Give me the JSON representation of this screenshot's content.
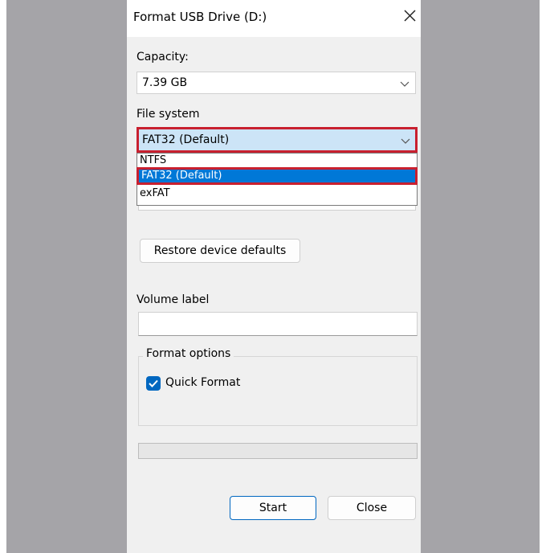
{
  "window": {
    "title": "Format USB Drive (D:)"
  },
  "capacity": {
    "label": "Capacity:",
    "value": "7.39 GB"
  },
  "file_system": {
    "label": "File system",
    "value": "FAT32 (Default)",
    "options": [
      "NTFS",
      "FAT32 (Default)",
      "exFAT"
    ],
    "highlighted_option": "FAT32 (Default)"
  },
  "buttons": {
    "restore_defaults": "Restore device defaults",
    "start": "Start",
    "close": "Close"
  },
  "volume_label": {
    "label": "Volume label",
    "value": ""
  },
  "format_options": {
    "legend": "Format options",
    "quick_format_label": "Quick Format",
    "quick_format_checked": true
  },
  "progress": {
    "value": 0
  },
  "colors": {
    "accent": "#0067c0",
    "highlight_border": "#c8202f",
    "selection": "#0078d7",
    "combo_focus_bg": "#cce4f7",
    "side_background": "#a5a4a8"
  }
}
